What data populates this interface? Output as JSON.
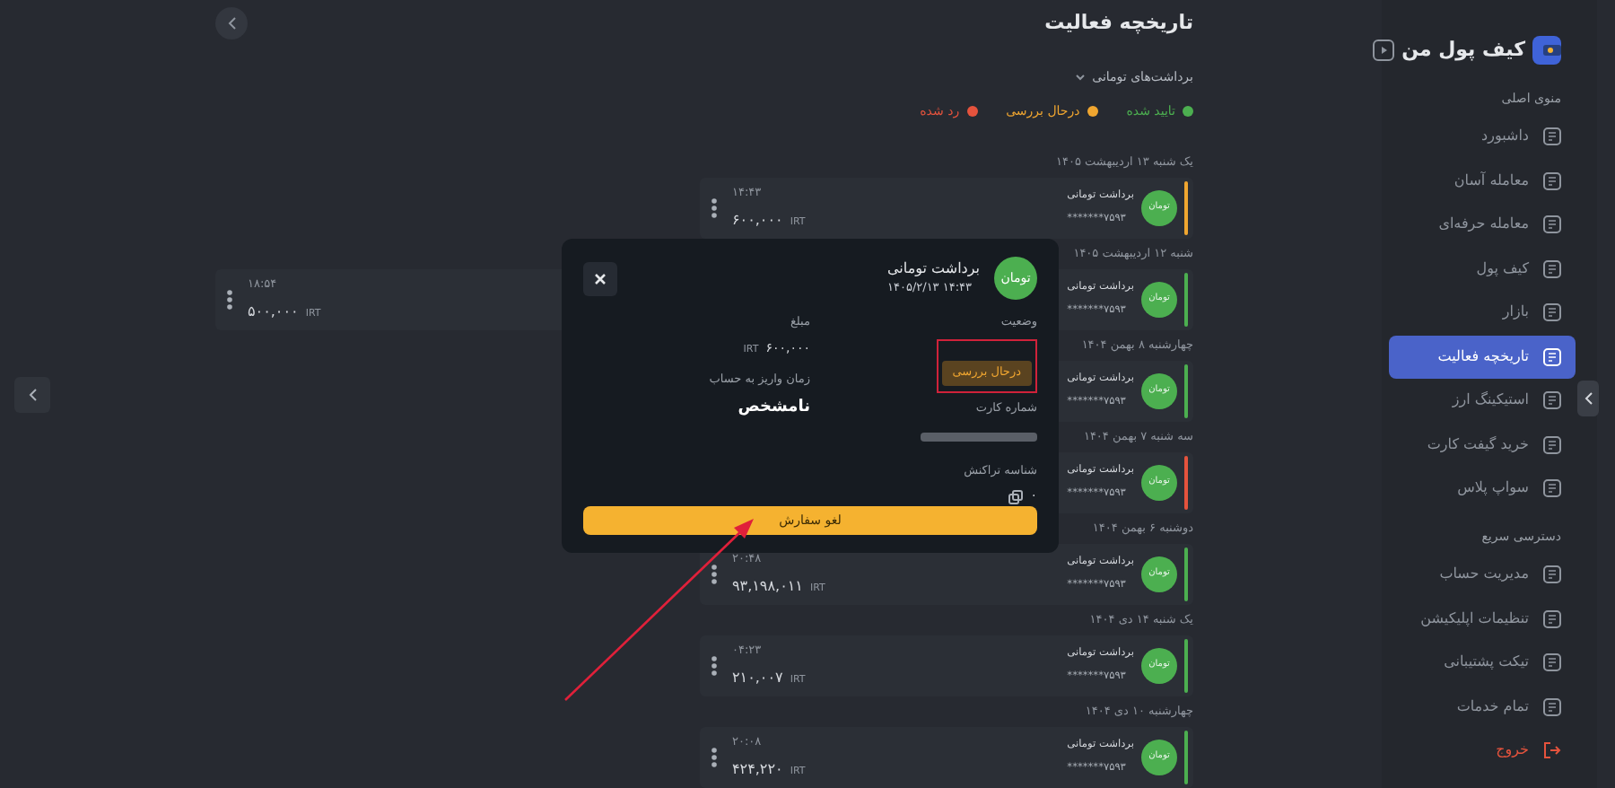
{
  "sidebar": {
    "logo": "کیف پول من",
    "sections": [
      {
        "title": "منوی اصلی",
        "items": [
          {
            "label": "داشبورد",
            "selected": false,
            "kind": "link"
          },
          {
            "label": "معامله آسان",
            "selected": false,
            "kind": "link"
          },
          {
            "label": "معامله حرفه‌ای",
            "selected": false,
            "kind": "link"
          },
          {
            "label": "کیف پول",
            "selected": false,
            "kind": "link"
          },
          {
            "label": "بازار",
            "selected": false,
            "kind": "link"
          },
          {
            "label": "تاریخچه فعالیت",
            "selected": true,
            "kind": "link"
          },
          {
            "label": "استیکینگ ارز",
            "selected": false,
            "kind": "link"
          },
          {
            "label": "خرید گیفت کارت",
            "selected": false,
            "kind": "link"
          },
          {
            "label": "سواپ پلاس",
            "selected": false,
            "kind": "link"
          }
        ]
      },
      {
        "title": "دسترسی سریع",
        "items": [
          {
            "label": "مدیریت حساب",
            "selected": false,
            "kind": "link"
          },
          {
            "label": "تنظیمات اپلیکیشن",
            "selected": false,
            "kind": "link"
          },
          {
            "label": "تیکت پشتیبانی",
            "selected": false,
            "kind": "link"
          },
          {
            "label": "تمام خدمات",
            "selected": false,
            "kind": "link"
          },
          {
            "label": "خروج",
            "selected": false,
            "kind": "logout"
          }
        ]
      }
    ]
  },
  "page": {
    "title": "تاریخچه فعالیت",
    "filter": "برداشت‌های تومانی",
    "legend": [
      {
        "label": "تایید شده",
        "color": "#4caf50"
      },
      {
        "label": "درحال بررسی",
        "color": "#f0a630"
      },
      {
        "label": "رد شده",
        "color": "#e5533d"
      }
    ]
  },
  "groups": [
    {
      "date": "یک شنبه ۱۳ اردیبهشت ۱۴۰۵",
      "rows": [
        {
          "kind": "normal",
          "avatar": "تومان",
          "title": "برداشت  تومانی",
          "card": "*******۷۵۹۳",
          "time": "۱۴:۴۳",
          "amount": "۶۰۰,۰۰۰",
          "currency": "IRT",
          "color": "#f0a630"
        }
      ]
    },
    {
      "date": "شنبه ۱۲ اردیبهشت ۱۴۰۵",
      "rows": [
        {
          "kind": "wide",
          "avatar": "تومان",
          "title": "برداشت  تومانی",
          "card": "*******۷۵۹۳",
          "time": "۱۸:۵۴",
          "amount": "۵۰۰,۰۰۰",
          "currency": "IRT",
          "color": "#4caf50"
        }
      ]
    },
    {
      "date": "چهارشنبه ۸ بهمن ۱۴۰۴",
      "rows": [
        {
          "kind": "normal",
          "avatar": "تومان",
          "title": "برداشت  تومانی",
          "card": "*******۷۵۹۳",
          "color": "#4caf50"
        }
      ]
    },
    {
      "date": "سه شنبه ۷ بهمن ۱۴۰۴",
      "rows": [
        {
          "kind": "normal",
          "avatar": "تومان",
          "title": "برداشت  تومانی",
          "card": "*******۷۵۹۳",
          "color": "#e5533d"
        }
      ]
    },
    {
      "date": "دوشنبه ۶ بهمن ۱۴۰۴",
      "rows": [
        {
          "kind": "normal",
          "avatar": "تومان",
          "title": "برداشت  تومانی",
          "card": "*******۷۵۹۳",
          "time": "۲۰:۴۸",
          "amount": "۹۳,۱۹۸,۰۱۱",
          "currency": "IRT",
          "color": "#4caf50"
        }
      ]
    },
    {
      "date": "یک شنبه ۱۴ دی ۱۴۰۴",
      "rows": [
        {
          "kind": "normal",
          "avatar": "تومان",
          "title": "برداشت  تومانی",
          "card": "*******۷۵۹۳",
          "time": "۰۴:۲۳",
          "amount": "۲۱۰,۰۰۷",
          "currency": "IRT",
          "color": "#4caf50"
        }
      ]
    },
    {
      "date": "چهارشنبه ۱۰ دی ۱۴۰۴",
      "rows": [
        {
          "kind": "normal",
          "avatar": "تومان",
          "title": "برداشت  تومانی",
          "card": "*******۷۵۹۳",
          "time": "۲۰:۰۸",
          "amount": "۴۲۴,۲۲۰",
          "currency": "IRT",
          "color": "#4caf50"
        }
      ]
    }
  ],
  "modal": {
    "avatar": "تومان",
    "title": "برداشت  تومانی",
    "datetime": "۱۴۰۵/۲/۱۳ ۱۴:۴۳",
    "status_label": "وضعیت",
    "status": "درحال بررسی",
    "status_highlighted": true,
    "card_label": "شماره کارت",
    "txid_label": "شناسه تراکنش",
    "txid": "۰",
    "amount_label": "مبلغ",
    "amount": "۶۰۰,۰۰۰",
    "currency": "IRT",
    "deposit_label": "زمان واریز به حساب",
    "deposit": "نامشخص",
    "cancel_button": "لغو سفارش"
  },
  "annotation_arrow": true
}
